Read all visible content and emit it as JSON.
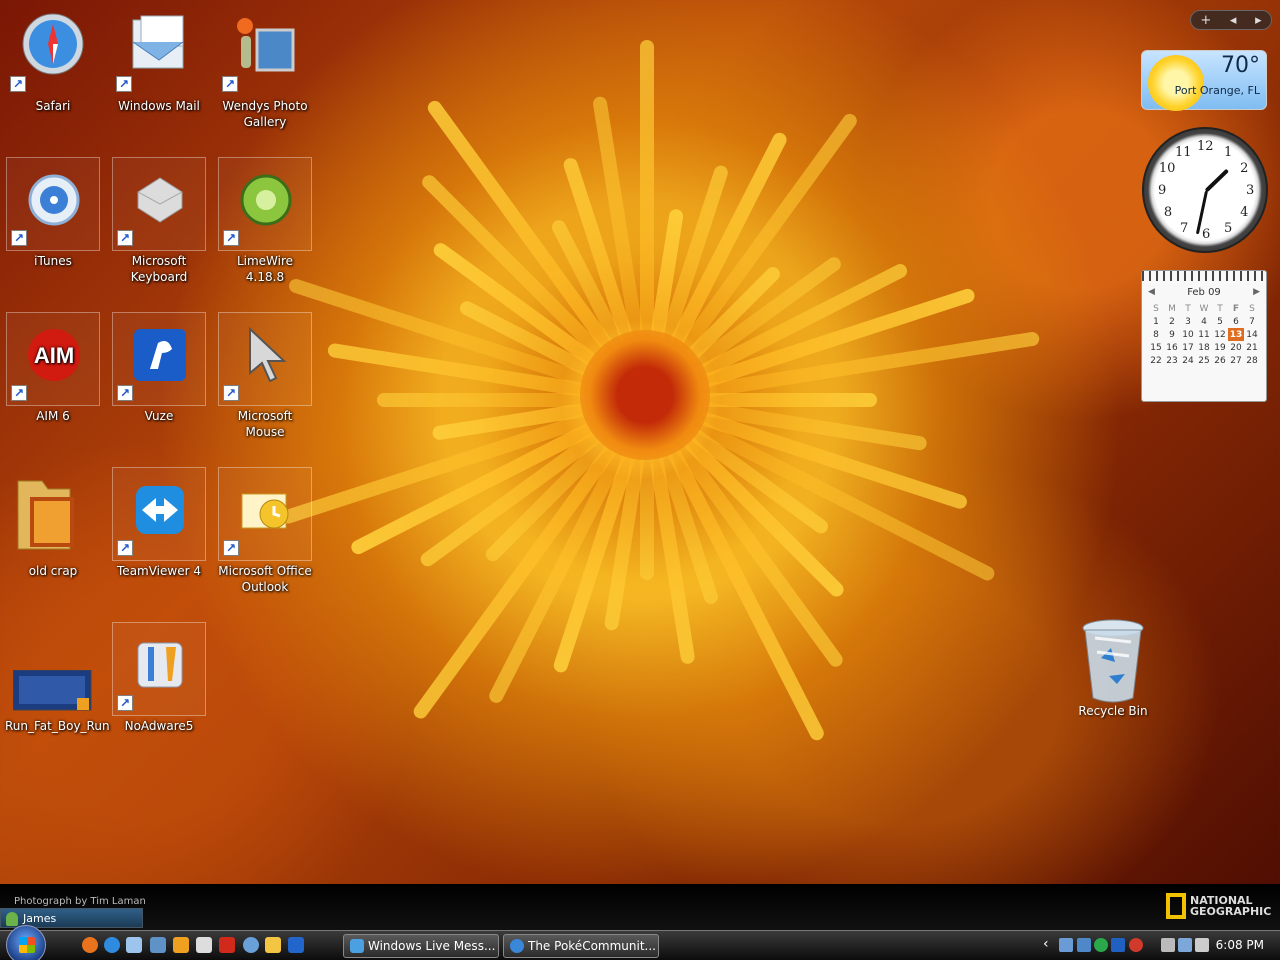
{
  "desktop": {
    "icons": [
      {
        "label": "Safari"
      },
      {
        "label": "Windows Mail"
      },
      {
        "label": "Wendys Photo Gallery"
      },
      {
        "label": "iTunes"
      },
      {
        "label": "Microsoft Keyboard"
      },
      {
        "label": "LimeWire 4.18.8"
      },
      {
        "label": "AIM 6"
      },
      {
        "label": "Vuze"
      },
      {
        "label": "Microsoft Mouse"
      },
      {
        "label": "old crap"
      },
      {
        "label": "TeamViewer 4"
      },
      {
        "label": "Microsoft Office Outlook"
      },
      {
        "label": "Run_Fat_Boy_Run"
      },
      {
        "label": "NoAdware5"
      }
    ],
    "recycle_bin": "Recycle Bin",
    "aim_logo_text": "AIM"
  },
  "sidebar": {
    "add": "+",
    "weather": {
      "temperature": "70°",
      "city": "Port Orange, FL"
    },
    "clock": {
      "numbers": [
        "12",
        "1",
        "2",
        "3",
        "4",
        "5",
        "6",
        "7",
        "8",
        "9",
        "10",
        "11"
      ],
      "hour": 1,
      "minute": 32
    },
    "calendar": {
      "month": "Feb 09",
      "dow": [
        "S",
        "M",
        "T",
        "W",
        "T",
        "F",
        "S"
      ],
      "weeks": [
        [
          "1",
          "2",
          "3",
          "4",
          "5",
          "6",
          "7"
        ],
        [
          "8",
          "9",
          "10",
          "11",
          "12",
          "13",
          "14"
        ],
        [
          "15",
          "16",
          "17",
          "18",
          "19",
          "20",
          "21"
        ],
        [
          "22",
          "23",
          "24",
          "25",
          "26",
          "27",
          "28"
        ]
      ],
      "today": "13"
    }
  },
  "wallpaper": {
    "credit": "Photograph by Tim Laman",
    "brand": "NATIONAL GEOGRAPHIC"
  },
  "user": {
    "name": "James"
  },
  "taskbar": {
    "tasks": [
      {
        "label": "Windows Live Mess..."
      },
      {
        "label": "The PokéCommunit..."
      }
    ],
    "tray_arrow": "‹",
    "time": "6:08 PM"
  }
}
